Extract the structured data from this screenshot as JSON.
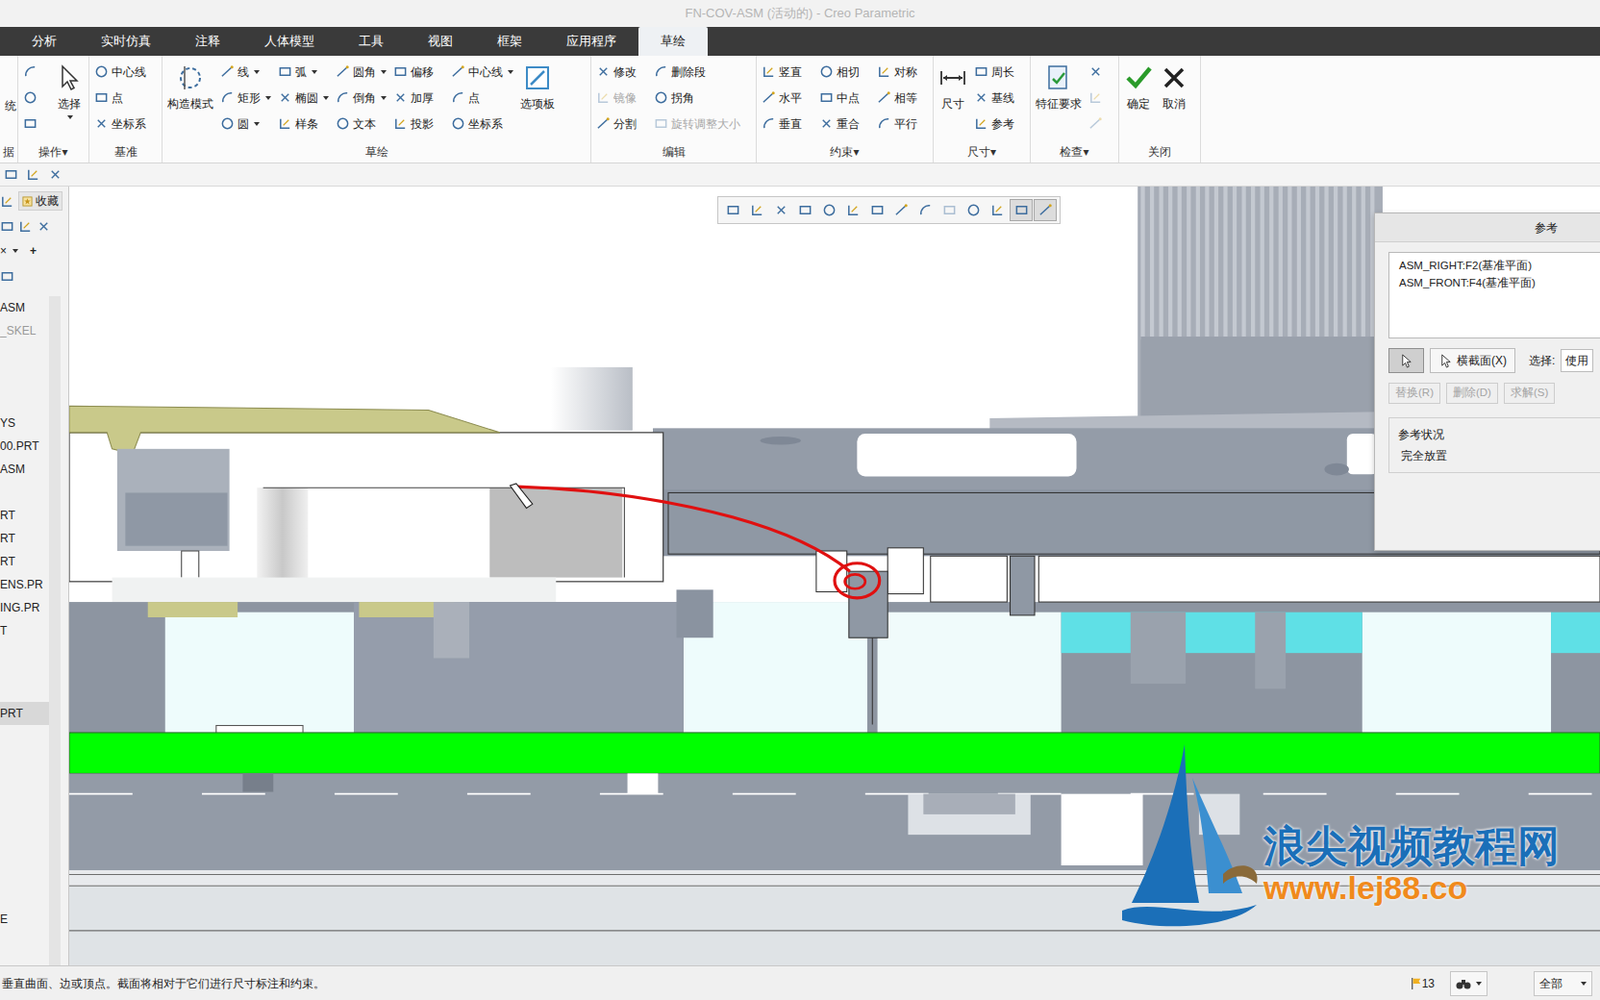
{
  "window": {
    "title": "FN-COV-ASM (活动的) - Creo Parametric"
  },
  "tabs": [
    {
      "label": "分析",
      "selected": false
    },
    {
      "label": "实时仿真",
      "selected": false
    },
    {
      "label": "注释",
      "selected": false
    },
    {
      "label": "人体模型",
      "selected": false
    },
    {
      "label": "工具",
      "selected": false
    },
    {
      "label": "视图",
      "selected": false
    },
    {
      "label": "框架",
      "selected": false
    },
    {
      "label": "应用程序",
      "selected": false
    },
    {
      "label": "草绘",
      "selected": true
    }
  ],
  "ribbon": {
    "groups": [
      {
        "label": "据",
        "columns": [
          [
            {
              "label": "统",
              "kind": "big",
              "dropdown": false,
              "disabled": false
            }
          ]
        ]
      },
      {
        "label": "操作▾",
        "columns": [
          [
            {
              "kind": "icon",
              "dropdown": false,
              "disabled": false
            },
            {
              "kind": "icon",
              "dropdown": false,
              "disabled": false
            },
            {
              "kind": "icon",
              "dropdown": false,
              "disabled": false
            }
          ],
          [
            {
              "label": "选择",
              "kind": "big",
              "dropdown": true,
              "disabled": false
            }
          ]
        ]
      },
      {
        "label": "基准",
        "columns": [
          [
            {
              "label": "中心线",
              "kind": "small",
              "dropdown": false,
              "disabled": false
            },
            {
              "label": "点",
              "kind": "small",
              "dropdown": false,
              "disabled": false
            },
            {
              "label": "坐标系",
              "kind": "small",
              "dropdown": false,
              "disabled": false
            }
          ]
        ]
      },
      {
        "label": "草绘",
        "columns": [
          [
            {
              "label": "构造模式",
              "kind": "big",
              "dropdown": false,
              "disabled": false
            }
          ],
          [
            {
              "label": "线",
              "kind": "small",
              "dropdown": true,
              "disabled": false
            },
            {
              "label": "矩形",
              "kind": "small",
              "dropdown": true,
              "disabled": false
            },
            {
              "label": "圆",
              "kind": "small",
              "dropdown": true,
              "disabled": false
            }
          ],
          [
            {
              "label": "弧",
              "kind": "small",
              "dropdown": true,
              "disabled": false
            },
            {
              "label": "椭圆",
              "kind": "small",
              "dropdown": true,
              "disabled": false
            },
            {
              "label": "样条",
              "kind": "small",
              "dropdown": false,
              "disabled": false
            }
          ],
          [
            {
              "label": "圆角",
              "kind": "small",
              "dropdown": true,
              "disabled": false
            },
            {
              "label": "倒角",
              "kind": "small",
              "dropdown": true,
              "disabled": false
            },
            {
              "label": "文本",
              "kind": "small",
              "dropdown": false,
              "disabled": false
            }
          ],
          [
            {
              "label": "偏移",
              "kind": "small",
              "dropdown": false,
              "disabled": false
            },
            {
              "label": "加厚",
              "kind": "small",
              "dropdown": false,
              "disabled": false
            },
            {
              "label": "投影",
              "kind": "small",
              "dropdown": false,
              "disabled": false
            }
          ],
          [
            {
              "label": "中心线",
              "kind": "small",
              "dropdown": true,
              "disabled": false
            },
            {
              "label": "点",
              "kind": "small",
              "dropdown": false,
              "disabled": false
            },
            {
              "label": "坐标系",
              "kind": "small",
              "dropdown": false,
              "disabled": false
            }
          ],
          [
            {
              "label": "选项板",
              "kind": "big",
              "dropdown": false,
              "disabled": false
            }
          ]
        ]
      },
      {
        "label": "编辑",
        "columns": [
          [
            {
              "label": "修改",
              "kind": "small",
              "dropdown": false,
              "disabled": false
            },
            {
              "label": "镜像",
              "kind": "small",
              "dropdown": false,
              "disabled": true
            },
            {
              "label": "分割",
              "kind": "small",
              "dropdown": false,
              "disabled": false
            }
          ],
          [
            {
              "label": "删除段",
              "kind": "small",
              "dropdown": false,
              "disabled": false
            },
            {
              "label": "拐角",
              "kind": "small",
              "dropdown": false,
              "disabled": false
            },
            {
              "label": "旋转调整大小",
              "kind": "small",
              "dropdown": false,
              "disabled": true
            }
          ]
        ]
      },
      {
        "label": "约束▾",
        "columns": [
          [
            {
              "label": "竖直",
              "kind": "small",
              "dropdown": false,
              "disabled": false
            },
            {
              "label": "水平",
              "kind": "small",
              "dropdown": false,
              "disabled": false
            },
            {
              "label": "垂直",
              "kind": "small",
              "dropdown": false,
              "disabled": false
            }
          ],
          [
            {
              "label": "相切",
              "kind": "small",
              "dropdown": false,
              "disabled": false
            },
            {
              "label": "中点",
              "kind": "small",
              "dropdown": false,
              "disabled": false
            },
            {
              "label": "重合",
              "kind": "small",
              "dropdown": false,
              "disabled": false
            }
          ],
          [
            {
              "label": "对称",
              "kind": "small",
              "dropdown": false,
              "disabled": false
            },
            {
              "label": "相等",
              "kind": "small",
              "dropdown": false,
              "disabled": false
            },
            {
              "label": "平行",
              "kind": "small",
              "dropdown": false,
              "disabled": false
            }
          ]
        ]
      },
      {
        "label": "尺寸▾",
        "columns": [
          [
            {
              "label": "尺寸",
              "kind": "big",
              "dropdown": false,
              "disabled": false
            }
          ],
          [
            {
              "label": "周长",
              "kind": "small",
              "dropdown": false,
              "disabled": false
            },
            {
              "label": "基线",
              "kind": "small",
              "dropdown": false,
              "disabled": false
            },
            {
              "label": "参考",
              "kind": "small",
              "dropdown": false,
              "disabled": false
            }
          ]
        ]
      },
      {
        "label": "检查▾",
        "columns": [
          [
            {
              "label": "特征要求",
              "kind": "big",
              "dropdown": false,
              "disabled": false
            }
          ],
          [
            {
              "kind": "icon",
              "dropdown": false,
              "disabled": false
            },
            {
              "kind": "icon",
              "dropdown": false,
              "disabled": true
            },
            {
              "kind": "icon",
              "dropdown": false,
              "disabled": true
            }
          ]
        ]
      },
      {
        "label": "关闭",
        "columns": [
          [
            {
              "label": "确定",
              "kind": "big",
              "dropdown": false,
              "disabled": false
            }
          ],
          [
            {
              "label": "取消",
              "kind": "big",
              "dropdown": false,
              "disabled": false
            }
          ]
        ]
      }
    ]
  },
  "navigator": {
    "favorites": "收藏",
    "clear": "×",
    "add": "+",
    "items": [
      {
        "label": "ASM",
        "greyed": false,
        "selected": false
      },
      {
        "label": "_SKEL",
        "greyed": true,
        "selected": false
      },
      {
        "label": "YS",
        "greyed": false,
        "selected": false
      },
      {
        "label": "00.PRT",
        "greyed": false,
        "selected": false
      },
      {
        "label": "ASM",
        "greyed": false,
        "selected": false
      },
      {
        "label": "RT",
        "greyed": false,
        "selected": false
      },
      {
        "label": "RT",
        "greyed": false,
        "selected": false
      },
      {
        "label": "RT",
        "greyed": false,
        "selected": false
      },
      {
        "label": "ENS.PR",
        "greyed": false,
        "selected": false
      },
      {
        "label": "ING.PR",
        "greyed": false,
        "selected": false
      },
      {
        "label": "T",
        "greyed": false,
        "selected": false
      },
      {
        "label": "PRT",
        "greyed": false,
        "selected": true
      },
      {
        "label": "E",
        "greyed": false,
        "selected": false
      }
    ]
  },
  "view_toolbar": {
    "buttons": [
      {
        "pressed": false,
        "disabled": false
      },
      {
        "pressed": false,
        "disabled": false
      },
      {
        "pressed": false,
        "disabled": false
      },
      {
        "pressed": false,
        "disabled": false
      },
      {
        "pressed": false,
        "disabled": false
      },
      {
        "pressed": false,
        "disabled": false
      },
      {
        "pressed": false,
        "disabled": false
      },
      {
        "pressed": false,
        "disabled": false
      },
      {
        "pressed": false,
        "disabled": false
      },
      {
        "pressed": false,
        "disabled": true
      },
      {
        "pressed": false,
        "disabled": false
      },
      {
        "pressed": false,
        "disabled": false
      },
      {
        "pressed": true,
        "disabled": false
      },
      {
        "pressed": true,
        "disabled": false
      }
    ]
  },
  "references_dialog": {
    "title": "参考",
    "references": [
      "ASM_RIGHT:F2(基准平面)",
      "ASM_FRONT:F4(基准平面)"
    ],
    "pick": {
      "selected": true
    },
    "section_button": "横截面(X)",
    "select_label": "选择:",
    "select_value": "使用",
    "actions": [
      {
        "label": "替换(R)",
        "disabled": true
      },
      {
        "label": "删除(D)",
        "disabled": true
      },
      {
        "label": "求解(S)",
        "disabled": true
      }
    ],
    "status_title": "参考状况",
    "status": "完全放置"
  },
  "watermark": {
    "brand": "浪尖视频教程网",
    "url": "www.lej88.co"
  },
  "status_bar": {
    "message": "垂直曲面、边或顶点。截面将相对于它们进行尺寸标注和约束。",
    "badge": "13",
    "filter": "全部"
  }
}
